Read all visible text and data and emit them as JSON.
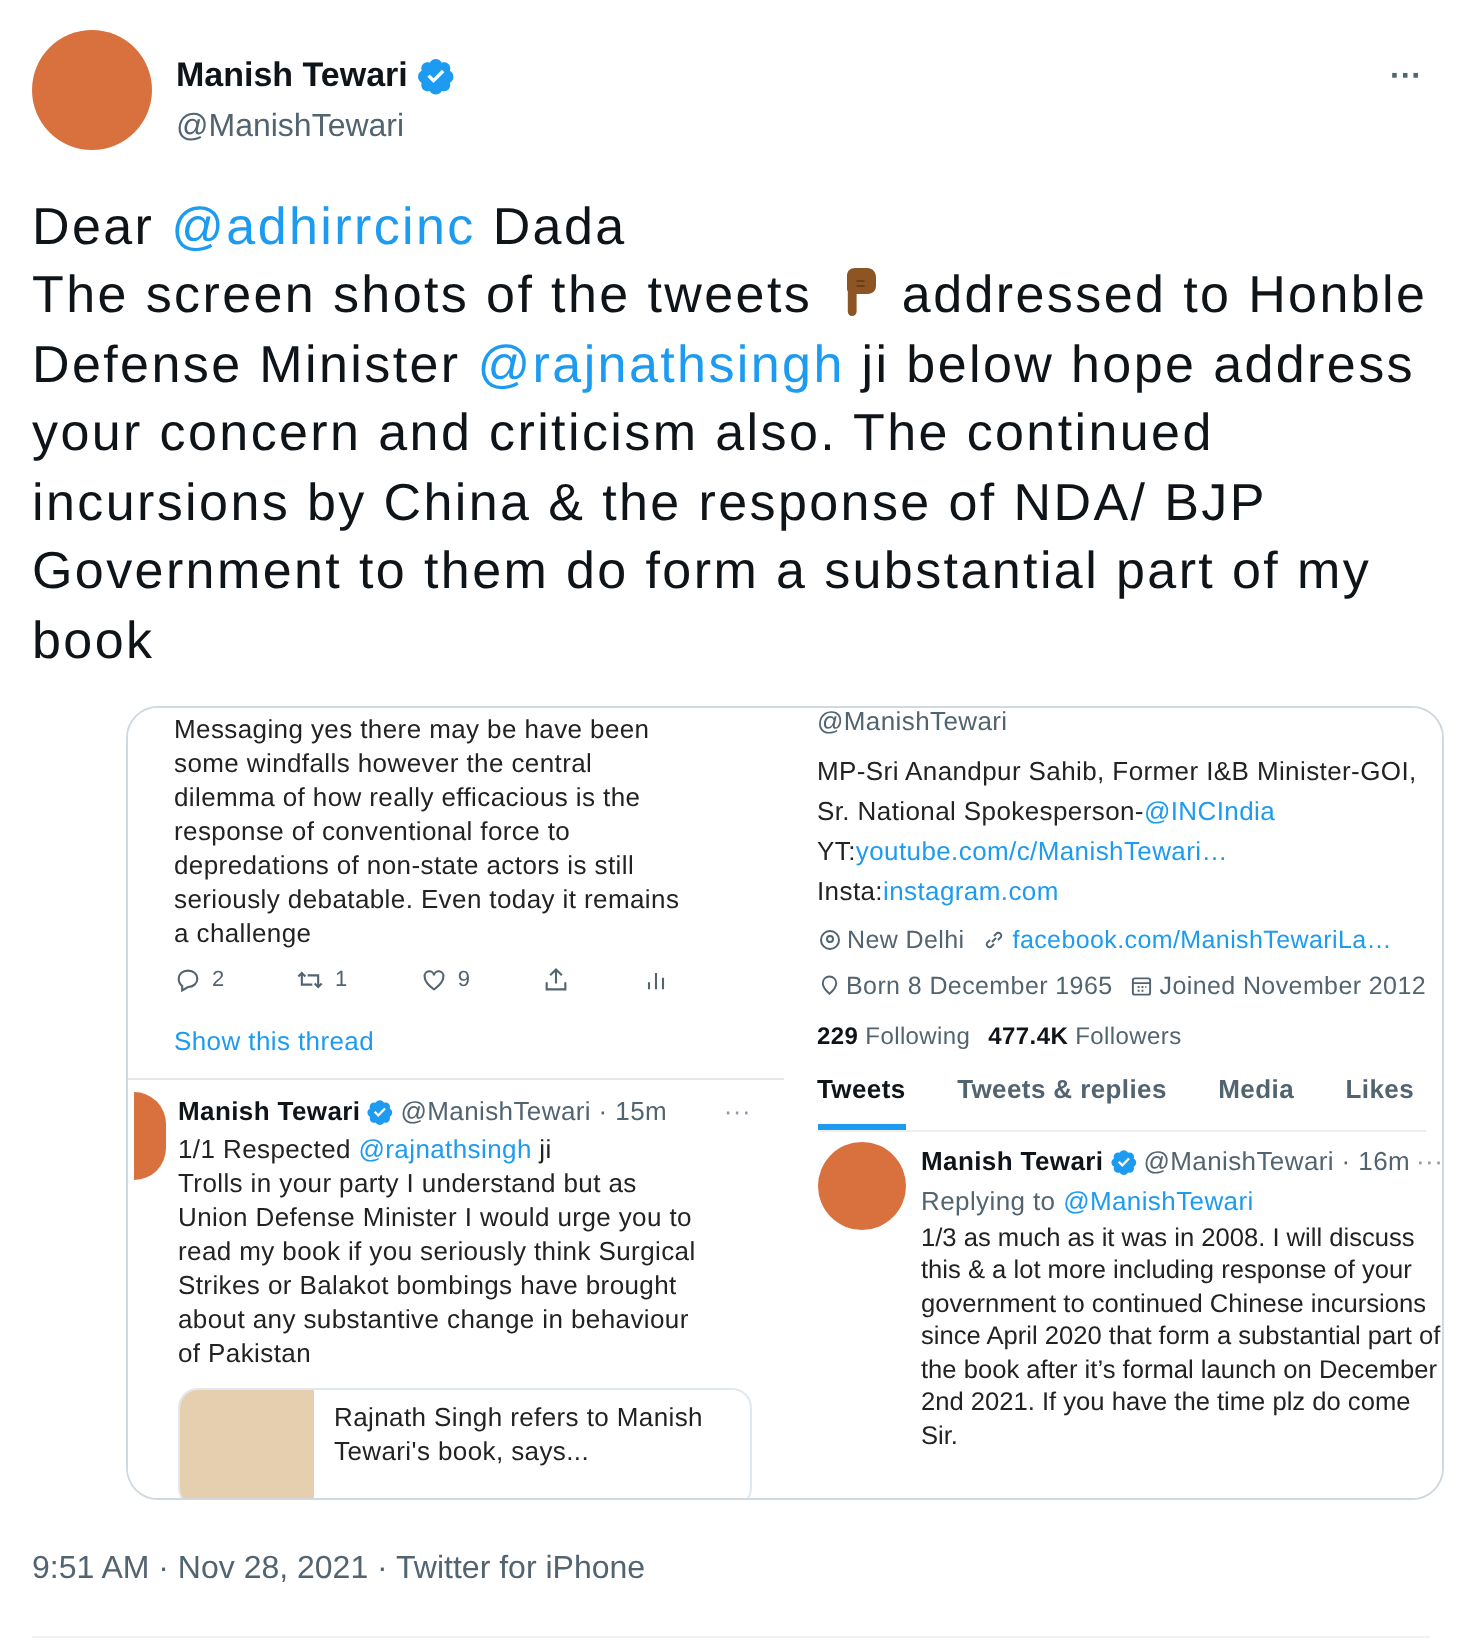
{
  "author": {
    "name": "Manish Tewari",
    "handle": "@ManishTewari",
    "verified": true
  },
  "more_label": "···",
  "body": [
    {
      "kind": "text",
      "text": "Dear "
    },
    {
      "kind": "mention",
      "text": "@adhirrcinc"
    },
    {
      "kind": "text",
      "text": " Dada"
    },
    {
      "kind": "break"
    },
    {
      "kind": "text",
      "text": "The screen shots of the tweets "
    },
    {
      "kind": "emoji"
    },
    {
      "kind": "text",
      "text": " addressed to Honble Defense Minister "
    },
    {
      "kind": "mention",
      "text": "@rajnathsingh"
    },
    {
      "kind": "text",
      "text": " ji below hope address your concern and criticism also. The continued incursions by China & the response of NDA/ BJP Government to them do form a substantial part of my book"
    }
  ],
  "left_image": {
    "thread_text": "Messaging yes there may be have been some windfalls however the central dilemma of how really efficacious is the response of conventional force to depredations of non-state actors is still seriously debatable. Even today it remains a challenge",
    "stats": [
      {
        "kind": "reply",
        "count": "2"
      },
      {
        "kind": "retweet",
        "count": "1"
      },
      {
        "kind": "like",
        "count": "9"
      },
      {
        "kind": "share"
      },
      {
        "kind": "analytics"
      }
    ],
    "show_thread": "Show this thread",
    "tweet": {
      "name": "Manish Tewari",
      "verified": true,
      "meta": "@ManishTewari · 15m",
      "more": "···",
      "body": [
        {
          "kind": "text",
          "text": "1/1 Respected "
        },
        {
          "kind": "mention",
          "text": "@rajnathsingh"
        },
        {
          "kind": "text",
          "text": " ji"
        },
        {
          "kind": "break"
        },
        {
          "kind": "text",
          "text": "Trolls in your party I understand but as Union Defense Minister I would urge you to read my book if you seriously think Surgical Strikes or Balakot bombings have brought about any substantive change in behaviour of Pakistan"
        }
      ],
      "card_title": "Rajnath Singh refers to Manish Tewari's book, says..."
    }
  },
  "right_image": {
    "handle": "@ManishTewari",
    "bio": [
      {
        "kind": "text",
        "text": "MP-Sri Anandpur Sahib, Former I&B Minister-GOI, Sr. National Spokesperson-"
      },
      {
        "kind": "mention",
        "text": "@INCIndia"
      },
      {
        "kind": "break"
      },
      {
        "kind": "text",
        "text": "YT:"
      },
      {
        "kind": "mention",
        "text": "youtube.com/c/ManishTewari…"
      },
      {
        "kind": "break"
      },
      {
        "kind": "text",
        "text": "Insta:"
      },
      {
        "kind": "mention",
        "text": "instagram.com"
      }
    ],
    "location": "New Delhi",
    "website": "facebook.com/ManishTewariLa…",
    "born": "Born 8 December 1965",
    "joined": "Joined November 2012",
    "following_count": "229",
    "following_label": "Following",
    "followers_count": "477.4K",
    "followers_label": "Followers",
    "tabs": [
      {
        "label": "Tweets",
        "selected": true
      },
      {
        "label": "Tweets & replies",
        "selected": false
      },
      {
        "label": "Media",
        "selected": false
      },
      {
        "label": "Likes",
        "selected": false
      }
    ],
    "tweet": {
      "name": "Manish Tewari",
      "verified": true,
      "meta": "@ManishTewari · 16m",
      "more": "···",
      "replying_label": "Replying to ",
      "replying_handle": "@ManishTewari",
      "body": "1/3 as much as it was in 2008. I will discuss this & a lot more including response of your government to continued Chinese incursions since April 2020 that form a substantial part of the book after it’s formal launch on December 2nd 2021. If you have the time plz do come Sir."
    }
  },
  "timestamp": "9:51 AM · Nov 28, 2021 · Twitter for iPhone"
}
